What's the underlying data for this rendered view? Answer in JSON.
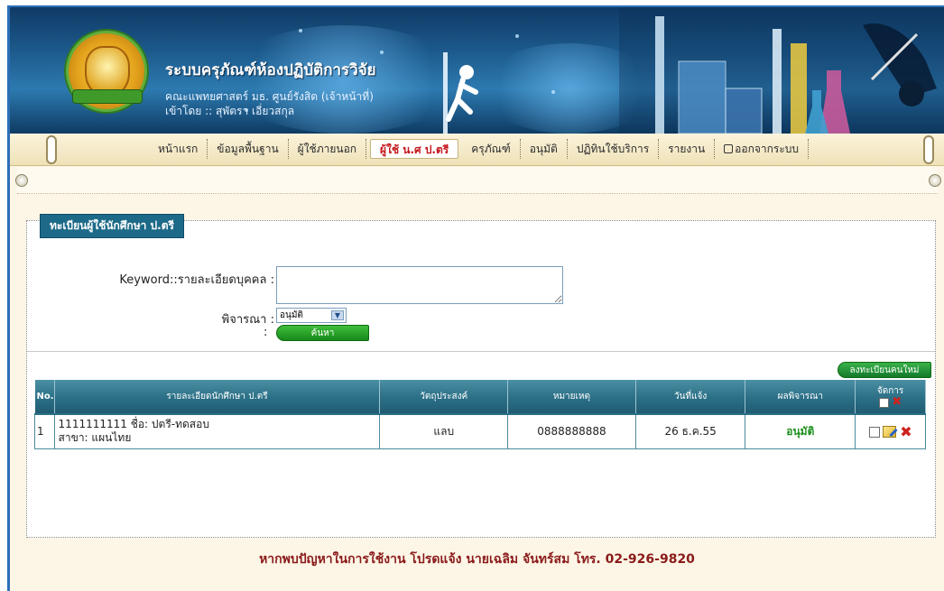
{
  "header": {
    "title": "ระบบครุภัณฑ์ห้องปฏิบัติการวิจัย",
    "subtitle": "คณะแพทยศาสตร์ มธ. ศูนย์รังสิต (เจ้าหน้าที่)",
    "login_info": "เข้าโดย :: สุพัตรา เอี่ยวสกุล"
  },
  "nav": {
    "items": [
      {
        "label": "หน้าแรก"
      },
      {
        "label": "ข้อมูลพื้นฐาน"
      },
      {
        "label": "ผู้ใช้ภายนอก"
      },
      {
        "label": "ผู้ใช้ น.ศ ป.ตรี"
      },
      {
        "label": "ครุภัณฑ์"
      },
      {
        "label": "อนุมัติ"
      },
      {
        "label": "ปฏิทินใช้บริการ"
      },
      {
        "label": "รายงาน"
      },
      {
        "label": "ออกจากระบบ"
      }
    ],
    "active_index": 3
  },
  "panel": {
    "title": "ทะเบียนผู้ใช้นักศึกษา ป.ตรี"
  },
  "search": {
    "keyword_label": "Keyword::รายละเอียดบุคคล :",
    "keyword_value": "",
    "status_label": "พิจารณา :",
    "status_value": "อนุมัติ",
    "colon": ":",
    "search_button": "ค้นหา"
  },
  "new_button": "ลงทะเบียนคนใหม่",
  "table": {
    "headers": {
      "no": "No.",
      "detail": "รายละเอียดนักศึกษา ป.ตรี",
      "purpose": "วัตถุประสงค์",
      "note": "หมายเหตุ",
      "date": "วันที่แจ้ง",
      "result": "ผลพิจารณา",
      "manage": "จัดการ"
    },
    "rows": [
      {
        "no": "1",
        "detail_line1": "1111111111 ชื่อ: ปตรี-ทดสอบ",
        "detail_line2": "สาขา: แผนไทย",
        "purpose": "แลบ",
        "note": "0888888888",
        "date": "26 ธ.ค.55",
        "result": "อนุมัติ"
      }
    ]
  },
  "footer": {
    "text": "หากพบปัญหาในการใช้งาน โปรดแจ้ง นายเฉลิม จันทร์สม โทร. 02-926-9820"
  },
  "colors": {
    "banner": "#1c5a8c",
    "nav_active": "#c4161c",
    "table_header": "#2b6f86",
    "approved": "#1c8f1c",
    "button_green": "#178a1a",
    "footer_text": "#8a1b1b"
  },
  "icons": [
    "university-seal-icon",
    "exit-icon",
    "dropdown-arrow-icon",
    "checkbox-icon",
    "edit-icon",
    "delete-icon"
  ]
}
